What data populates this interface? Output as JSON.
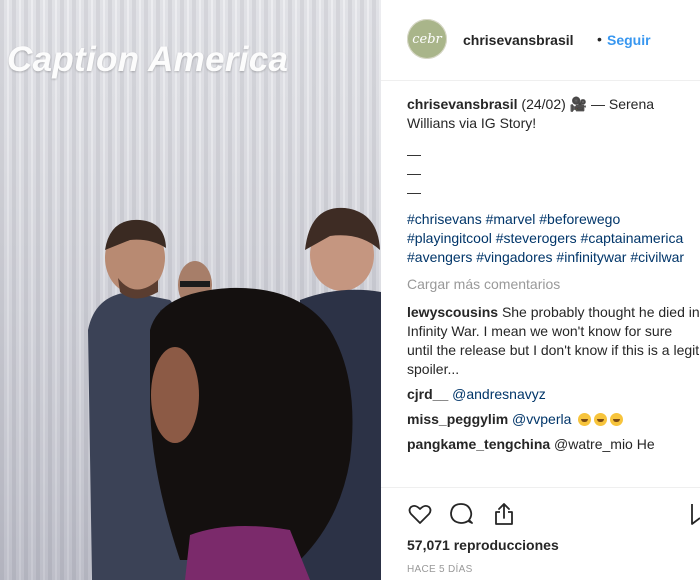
{
  "media": {
    "overlay_caption": "Caption America"
  },
  "post": {
    "avatar_text": "cebr",
    "username": "chrisevansbrasil",
    "separator": "•",
    "follow_label": "Seguir",
    "caption": {
      "username": "chrisevansbrasil",
      "text": "(24/02) 🎥 — Serena Willians via IG Story!",
      "dashes": [
        "—",
        "—",
        "—"
      ],
      "hashtags": "#chrisevans #marvel #beforewego #playingitcool #steverogers #captainamerica #avengers #vingadores #infinitywar #civilwar"
    },
    "load_more": "Cargar más comentarios",
    "comments": [
      {
        "username": "lewyscousins",
        "text": "She probably thought he died in Infinity War. I mean we won't know for sure until the release but I don't know if this is a legit spoiler..."
      },
      {
        "username": "cjrd__",
        "text": "@andresnavyz"
      },
      {
        "username": "miss_peggylim",
        "text": "@vvperla"
      },
      {
        "username": "pangkame_tengchina",
        "text": "@watre_mio He"
      }
    ],
    "views": "57,071 reproducciones",
    "timestamp": "HACE 5 DÍAS"
  },
  "icons": {
    "like": "heart-icon",
    "comment": "comment-icon",
    "share": "share-icon",
    "save": "bookmark-icon"
  }
}
